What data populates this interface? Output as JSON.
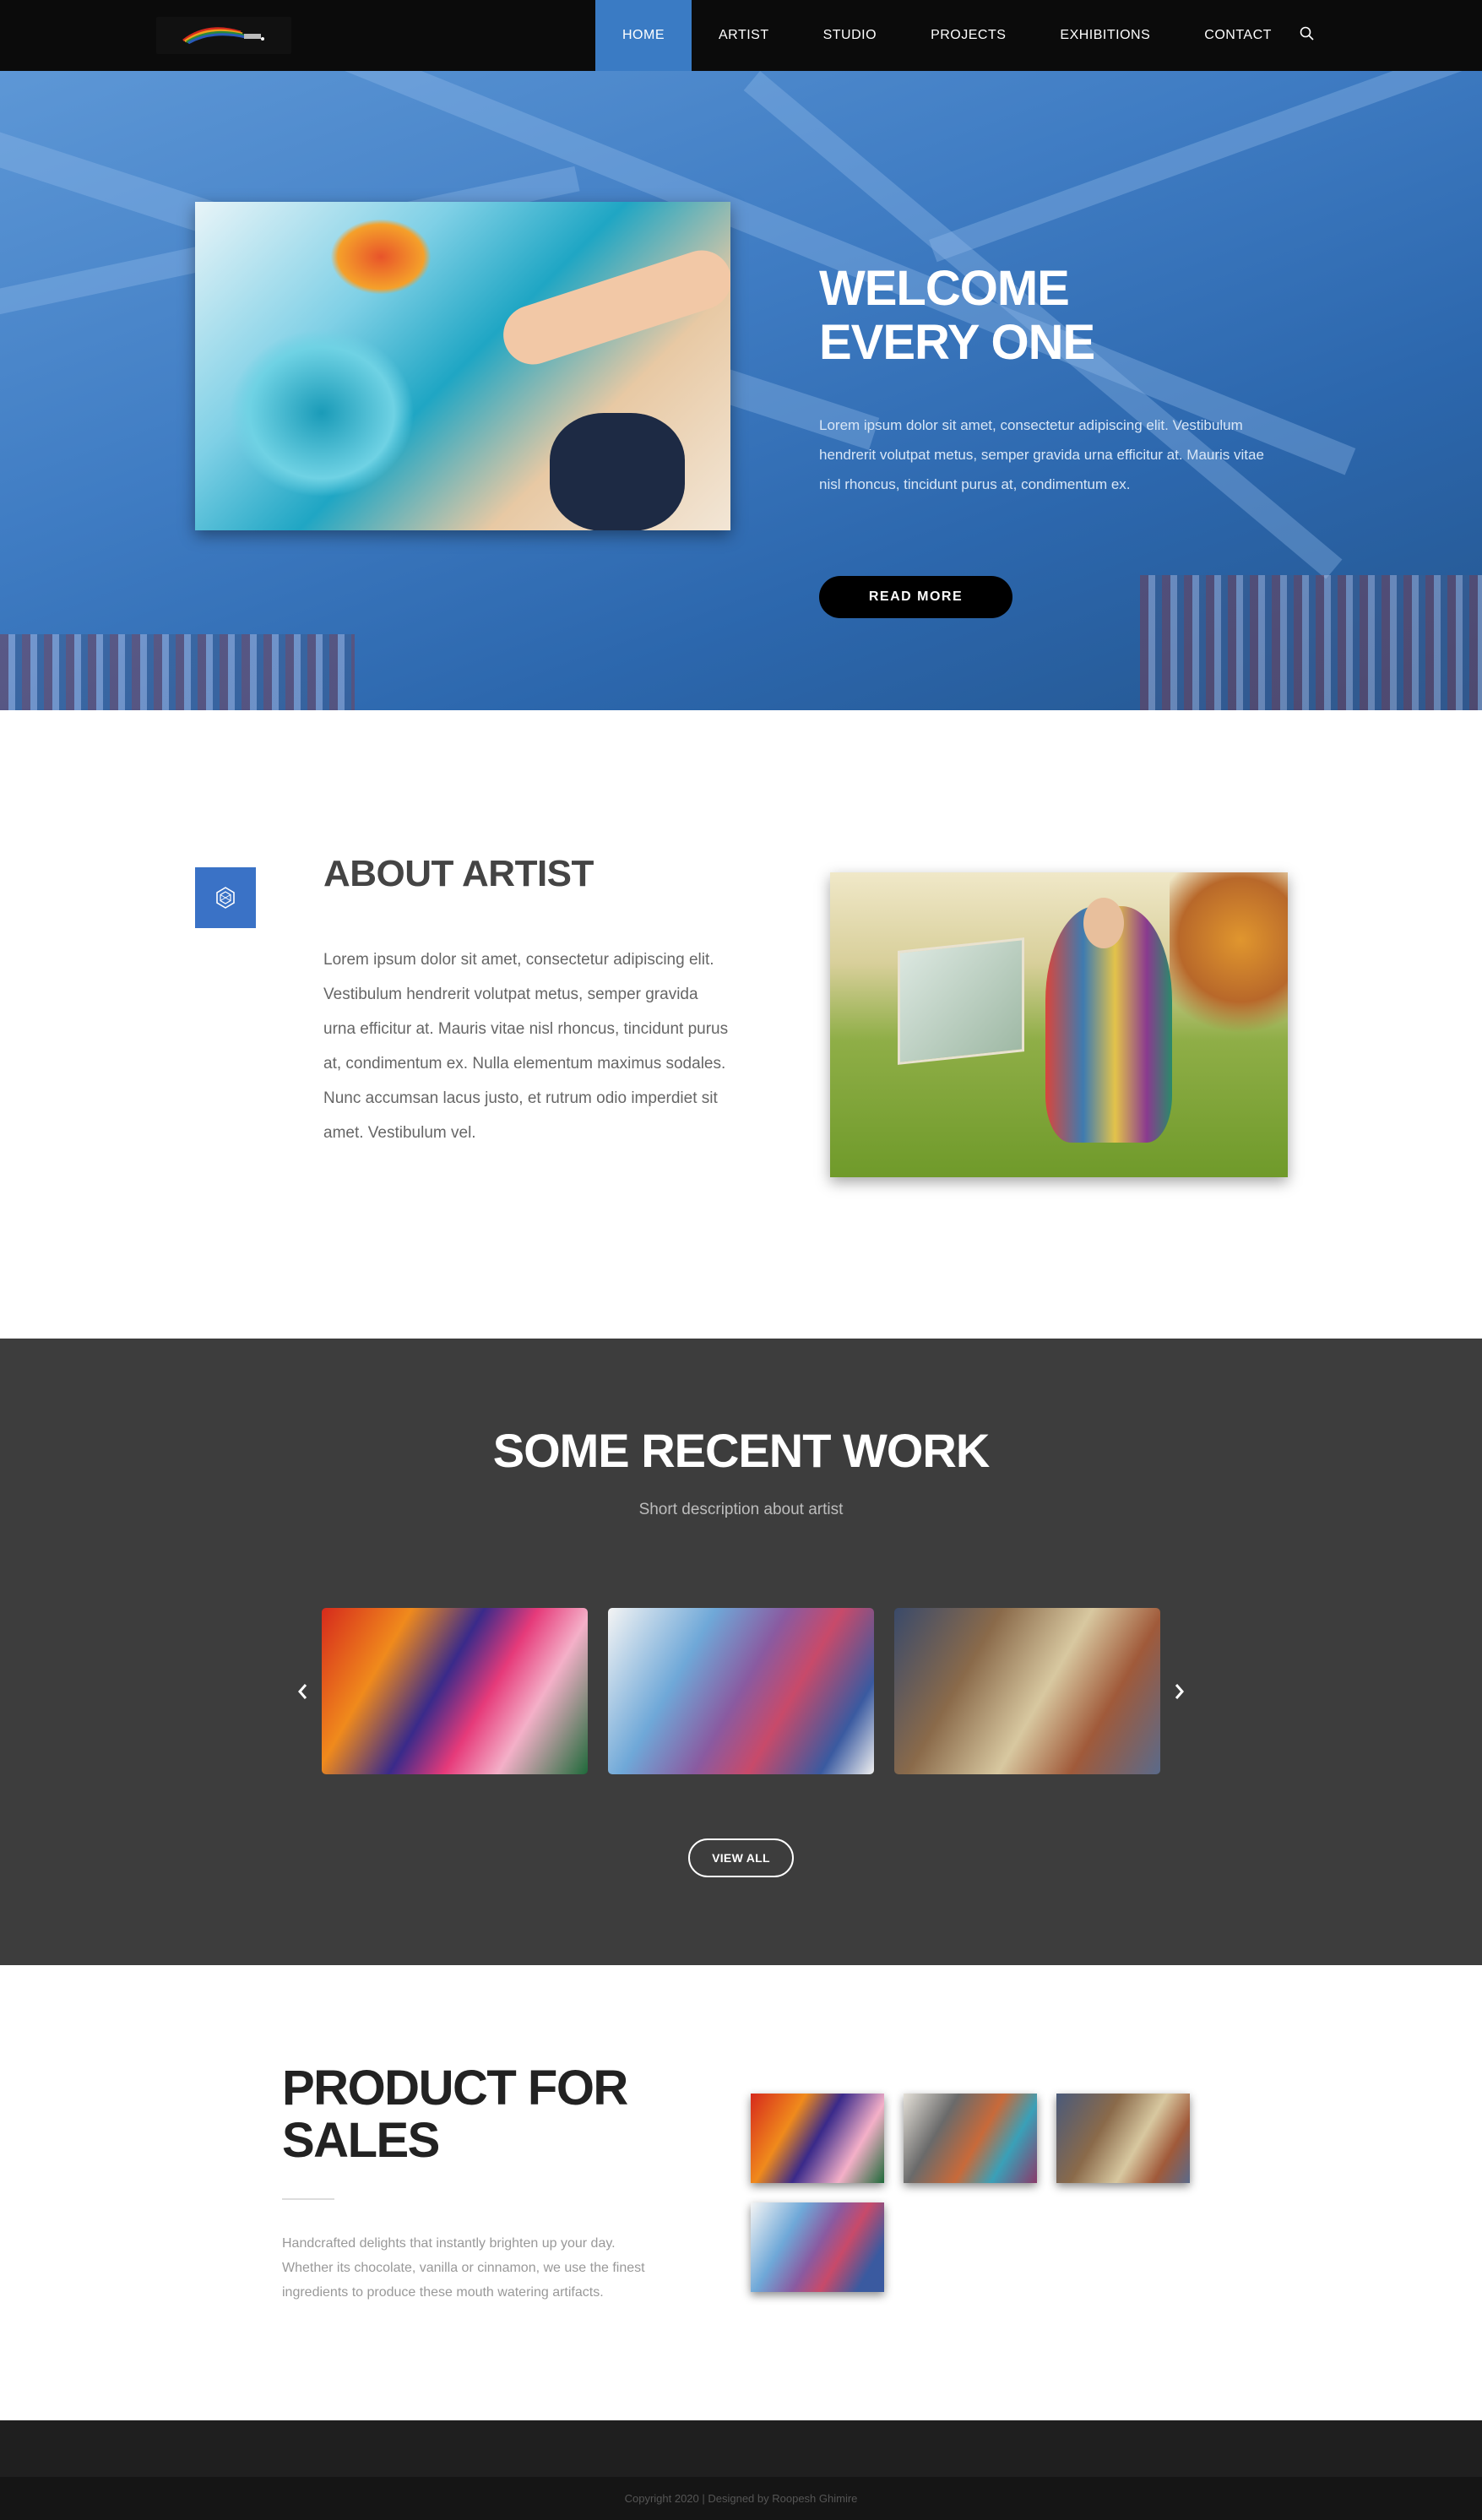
{
  "nav": {
    "items": [
      {
        "label": "HOME",
        "active": true
      },
      {
        "label": "ARTIST"
      },
      {
        "label": "STUDIO"
      },
      {
        "label": "PROJECTS"
      },
      {
        "label": "EXHIBITIONS"
      },
      {
        "label": "CONTACT"
      }
    ],
    "search_icon": "search-icon",
    "active_color": "#3a7bc4"
  },
  "hero": {
    "title_line1": "WELCOME",
    "title_line2": "EVERY ONE",
    "text": "Lorem ipsum dolor sit amet, consectetur adipiscing elit. Vestibulum hendrerit volutpat metus, semper gravida urna efficitur at. Mauris vitae nisl rhoncus, tincidunt purus at, condimentum ex.",
    "button": "READ MORE"
  },
  "about": {
    "title": "ABOUT ARTIST",
    "icon": "hexagon-icon",
    "icon_color": "#3a72c6",
    "text": "Lorem ipsum dolor sit amet, consectetur adipiscing elit. Vestibulum hendrerit volutpat metus, semper gravida urna efficitur at. Mauris vitae nisl rhoncus, tincidunt purus at, condimentum ex. Nulla elementum maximus sodales. Nunc accumsan lacus justo, et rutrum odio imperdiet sit amet. Vestibulum vel."
  },
  "work": {
    "title": "SOME RECENT WORK",
    "subtitle": "Short description about artist",
    "button": "VIEW ALL",
    "prev_icon": "chevron-left-icon",
    "next_icon": "chevron-right-icon",
    "background": "#3d3d3d"
  },
  "products": {
    "title_line1": "PRODUCT FOR",
    "title_line2": "SALES",
    "text": "Handcrafted delights that instantly brighten up your day. Whether its chocolate, vanilla or cinnamon, we use the finest ingredients to produce these mouth watering artifacts."
  },
  "footer": {
    "copyright": "Copyright 2020 | Designed by Roopesh Ghimire"
  }
}
